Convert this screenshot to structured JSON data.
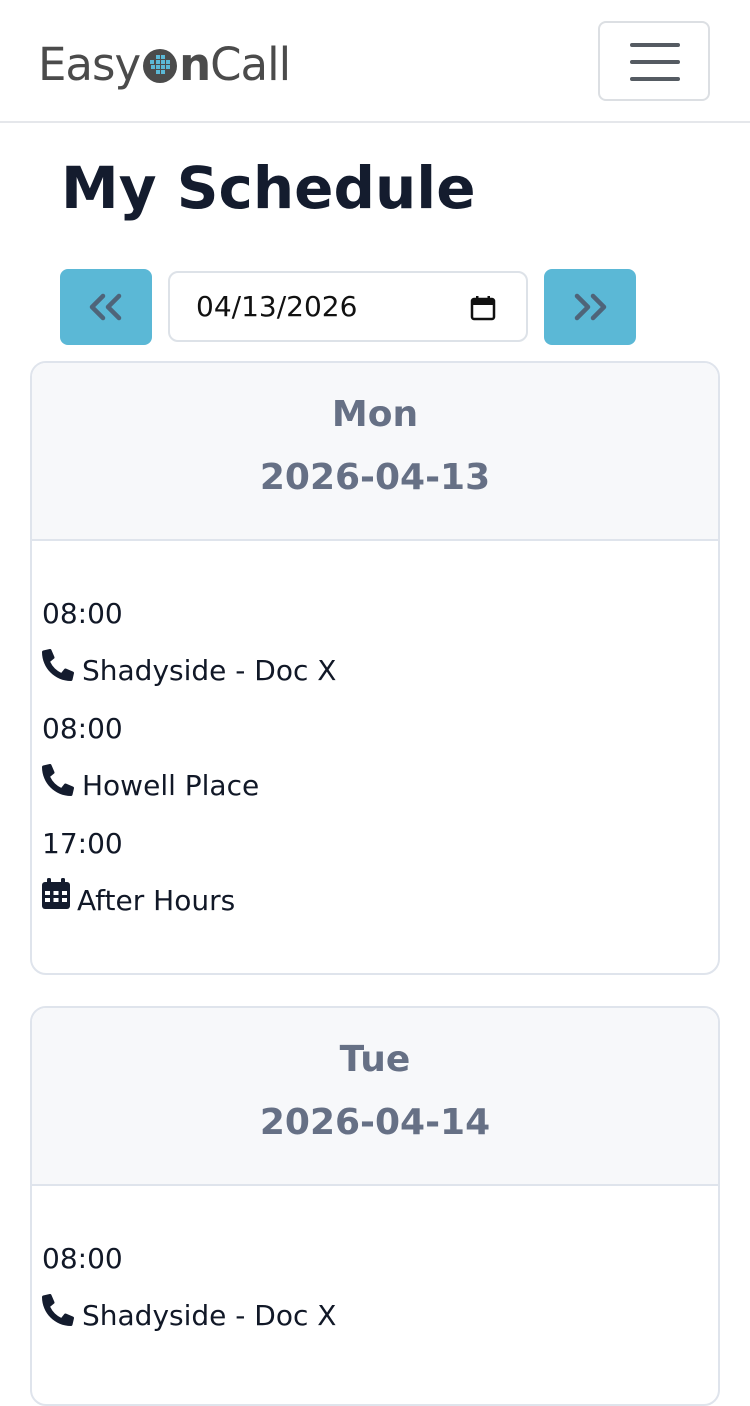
{
  "brand": {
    "prefix": "Easy",
    "bold": "n",
    "suffix": "Call",
    "accent_color": "#5bb8d6"
  },
  "navbar": {
    "toggle_icon": "hamburger-icon"
  },
  "page": {
    "title": "My Schedule"
  },
  "date_nav": {
    "prev_icon": "chevrons-left-icon",
    "next_icon": "chevrons-right-icon",
    "date_value": "04/13/2026",
    "calendar_icon": "calendar-icon",
    "button_color": "#5bb8d6"
  },
  "days": [
    {
      "weekday": "Mon",
      "date": "2026-04-13",
      "entries": [
        {
          "time": "08:00",
          "icon": "phone-icon",
          "name": "Shadyside - Doc X"
        },
        {
          "time": "08:00",
          "icon": "phone-icon",
          "name": "Howell Place"
        },
        {
          "time": "17:00",
          "icon": "calendar-icon",
          "name": "After Hours"
        }
      ]
    },
    {
      "weekday": "Tue",
      "date": "2026-04-14",
      "entries": [
        {
          "time": "08:00",
          "icon": "phone-icon",
          "name": "Shadyside - Doc X"
        }
      ]
    }
  ]
}
